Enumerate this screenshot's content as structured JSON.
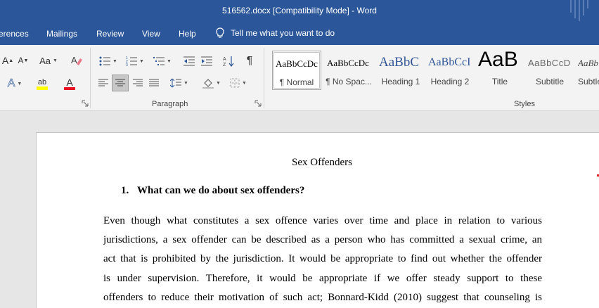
{
  "window": {
    "title": "516562.docx [Compatibility Mode]  -  Word"
  },
  "ribbon_tabs": [
    {
      "label": "erences"
    },
    {
      "label": "Mailings"
    },
    {
      "label": "Review"
    },
    {
      "label": "View"
    },
    {
      "label": "Help"
    }
  ],
  "tell_me": {
    "text": "Tell me what you want to do"
  },
  "font_group": {
    "grow_glyph": "A",
    "shrink_glyph": "A",
    "change_case_glyph": "Aa",
    "text_effects_glyph": "A",
    "highlight_glyph": "ab",
    "font_color_glyph": "A",
    "highlight_color": "#ffff00",
    "font_color": "#e81123"
  },
  "paragraph_group": {
    "label": "Paragraph",
    "pilcrow_glyph": "¶"
  },
  "styles_group": {
    "label": "Styles",
    "tiles": [
      {
        "preview": "AaBbCcDc",
        "name": "¶ Normal"
      },
      {
        "preview": "AaBbCcDc",
        "name": "¶ No Spac..."
      },
      {
        "preview": "AaBbC",
        "name": "Heading 1"
      },
      {
        "preview": "AaBbCcI",
        "name": "Heading 2"
      },
      {
        "preview": "AaB",
        "name": "Title"
      },
      {
        "preview": "AaBbCcD",
        "name": "Subtitle"
      },
      {
        "preview": "AaBb",
        "name": "Subtle"
      }
    ]
  },
  "colors": {
    "accent": "#2b579a",
    "ribbon_bg": "#f3f3f3",
    "heading_blue": "#2f5496"
  },
  "document": {
    "title": "Sex Offenders",
    "heading_number": "1.",
    "heading_text": "What can we do about sex offenders?",
    "lines": [
      "Even though what constitutes a sex offence varies over time and place in relation to various",
      "jurisdictions, a sex offender can be described as a person who has committed a sexual crime, an",
      "act that is prohibited by the jurisdiction. It would be appropriate to find out whether the offender",
      "is under supervision. Therefore, it would be appropriate if we offer steady support to these",
      "offenders to reduce their motivation of such act; Bonnard-Kidd (2010) suggest that counseling is"
    ]
  }
}
